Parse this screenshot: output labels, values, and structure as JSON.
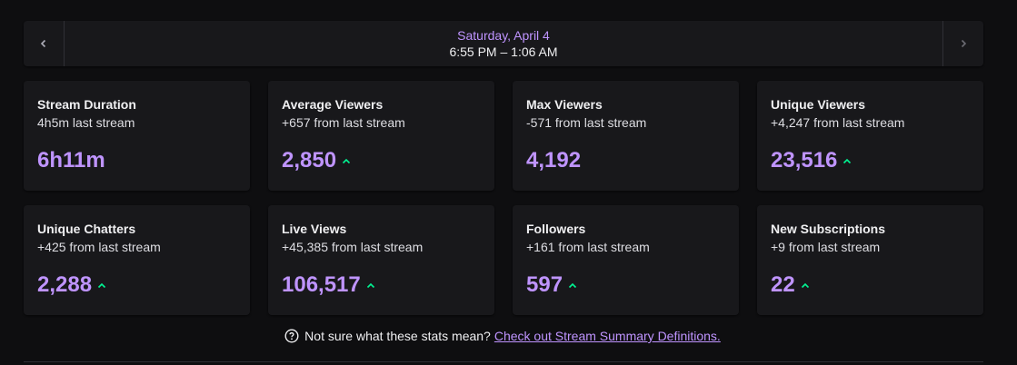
{
  "date_nav": {
    "day": "Saturday, April 4",
    "time_range": "6:55 PM – 1:06 AM",
    "prev_icon": "chevron-left-icon",
    "next_icon": "chevron-right-icon"
  },
  "colors": {
    "accent": "#bf94ff",
    "trend_up": "#00f593",
    "card_bg": "#18181b",
    "page_bg": "#0e0e10"
  },
  "cards": [
    {
      "title": "Stream Duration",
      "subtitle": "4h5m last stream",
      "value": "6h11m",
      "trend": "none"
    },
    {
      "title": "Average Viewers",
      "subtitle": "+657 from last stream",
      "value": "2,850",
      "trend": "up"
    },
    {
      "title": "Max Viewers",
      "subtitle": "-571 from last stream",
      "value": "4,192",
      "trend": "none"
    },
    {
      "title": "Unique Viewers",
      "subtitle": "+4,247 from last stream",
      "value": "23,516",
      "trend": "up"
    },
    {
      "title": "Unique Chatters",
      "subtitle": "+425 from last stream",
      "value": "2,288",
      "trend": "up"
    },
    {
      "title": "Live Views",
      "subtitle": "+45,385 from last stream",
      "value": "106,517",
      "trend": "up"
    },
    {
      "title": "Followers",
      "subtitle": "+161 from last stream",
      "value": "597",
      "trend": "up"
    },
    {
      "title": "New Subscriptions",
      "subtitle": "+9 from last stream",
      "value": "22",
      "trend": "up"
    }
  ],
  "footer": {
    "question": "Not sure what these stats mean?",
    "link_text": "Check out Stream Summary Definitions.",
    "icon": "question-circle-icon"
  }
}
